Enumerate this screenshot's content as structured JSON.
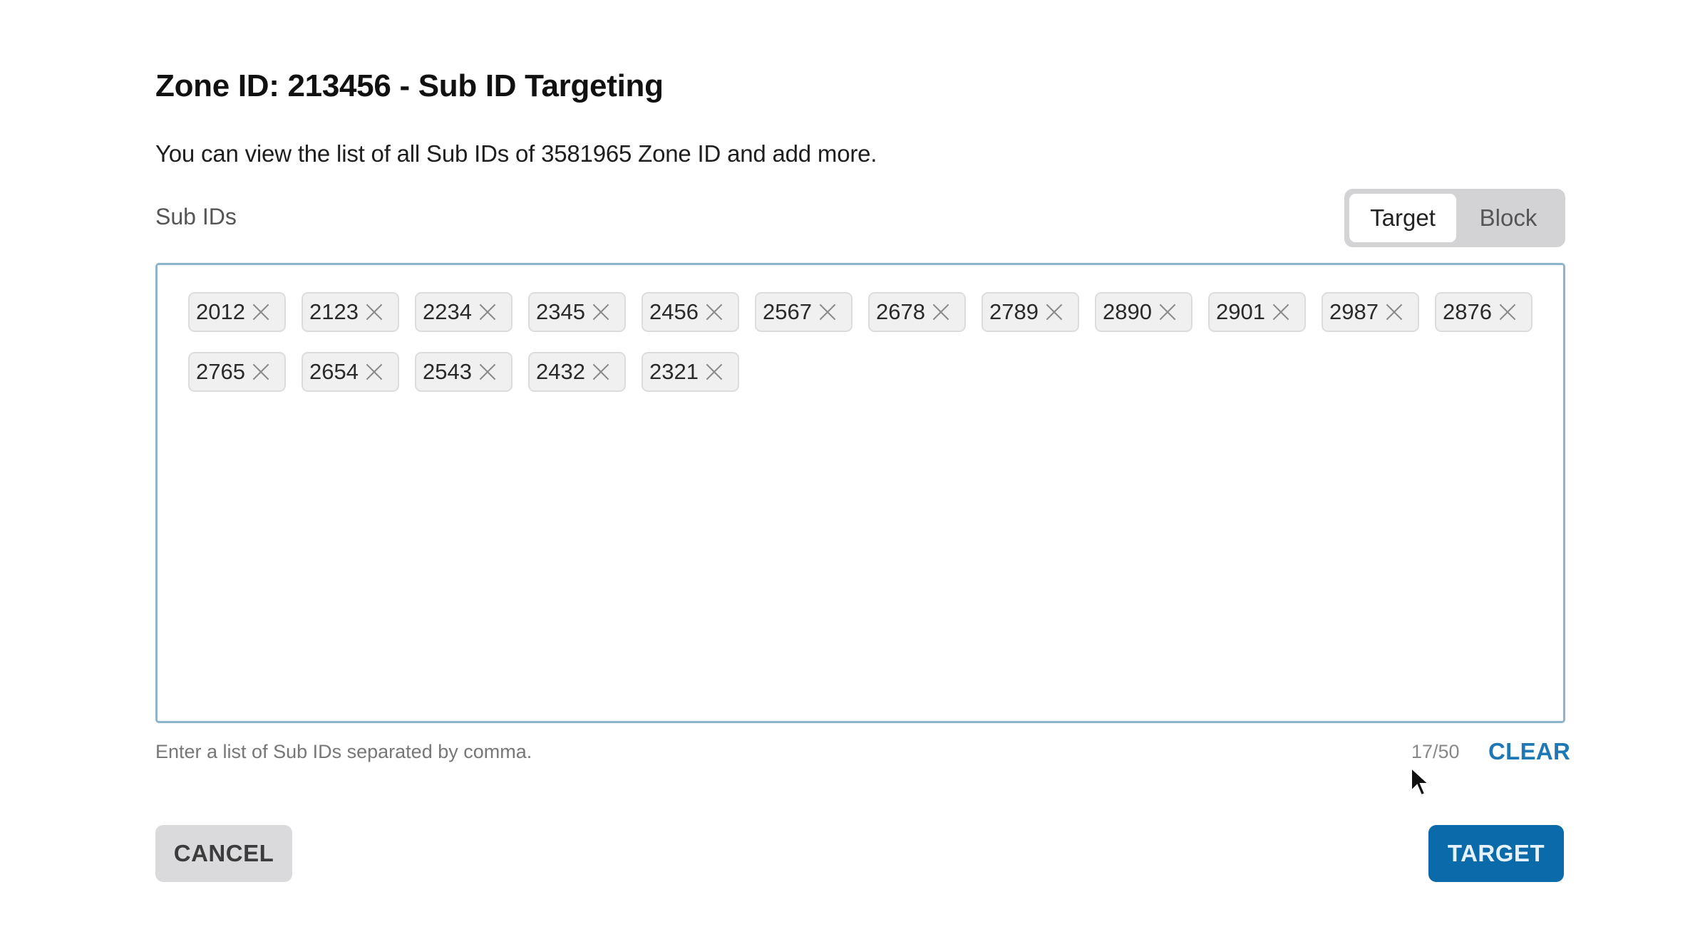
{
  "dialog": {
    "title": "Zone ID: 213456 - Sub ID Targeting",
    "description": "You can view the list of all Sub IDs of 3581965 Zone ID and add more."
  },
  "sub_ids": {
    "label": "Sub IDs",
    "mode_toggle": {
      "options": [
        "Target",
        "Block"
      ],
      "selected": "Target"
    },
    "chips": [
      "2012",
      "2123",
      "2234",
      "2345",
      "2456",
      "2567",
      "2678",
      "2789",
      "2890",
      "2901",
      "2987",
      "2876",
      "2765",
      "2654",
      "2543",
      "2432",
      "2321"
    ],
    "chip_remove_icon": "close-icon",
    "helper_text": "Enter a list of Sub IDs separated by comma.",
    "counter": "17/50",
    "clear_label": "CLEAR"
  },
  "footer": {
    "cancel_label": "CANCEL",
    "target_label": "TARGET"
  },
  "colors": {
    "primary": "#0b6aa9",
    "link": "#1f78b4",
    "field_border": "#8db3cf",
    "chip_bg": "#f0f0f1",
    "toggle_bg": "#d3d3d5"
  }
}
